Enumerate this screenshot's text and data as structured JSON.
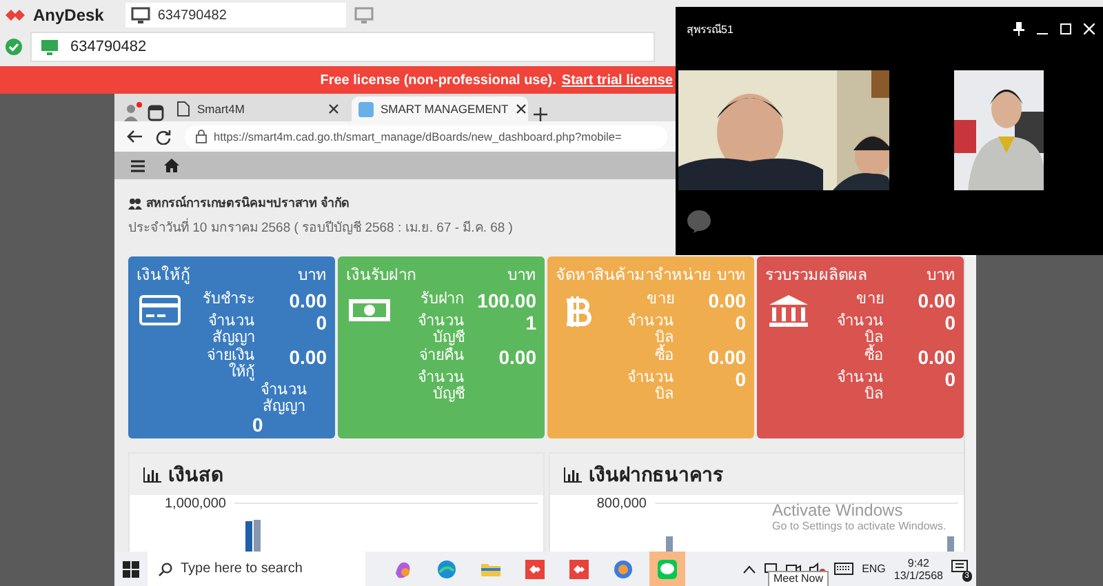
{
  "anydesk": {
    "app_name": "AnyDesk",
    "tab": {
      "label": "634790482"
    },
    "address": {
      "value": "634790482"
    },
    "banner": {
      "text": "Free license (non-professional use).",
      "link": "Start trial license"
    }
  },
  "browser": {
    "tabs": [
      {
        "label": "Smart4M",
        "selected": false
      },
      {
        "label": "SMART MANAGEMENT",
        "selected": true
      }
    ],
    "url": "https://smart4m.cad.go.th/smart_manage/dBoards/new_dashboard.php?mobile="
  },
  "page": {
    "org": "สหกรณ์การเกษตรนิคมฯปราสาท จำกัด",
    "date_line": "ประจำวันที่ 10 มกราคม 2568 ( รอบปีบัญชี 2568 : เม.ย. 67 - มี.ค. 68 )",
    "cards": [
      {
        "title": "เงินให้กู้",
        "unit": "บาท",
        "color": "#3a7bbf",
        "rows": [
          {
            "label": "รับชำระ",
            "value": "0.00"
          },
          {
            "label": "จำนวน สัญญา",
            "value": "0"
          },
          {
            "label": "จ่ายเงิน ให้กู้",
            "value": "0.00"
          },
          {
            "kind": "stacked",
            "label": "จำนวน สัญญา",
            "value": "0"
          }
        ]
      },
      {
        "title": "เงินรับฝาก",
        "unit": "บาท",
        "color": "#5cb85c",
        "rows": [
          {
            "label": "รับฝาก",
            "value": "100.00"
          },
          {
            "label": "จำนวน บัญชี",
            "value": "1"
          },
          {
            "label": "จ่ายคืน",
            "value": "0.00"
          },
          {
            "label": "จำนวน บัญชี"
          }
        ]
      },
      {
        "title": "จัดหาสินค้ามาจำหน่าย",
        "unit": "บาท",
        "color": "#f0ad4e",
        "rows": [
          {
            "label": "ขาย",
            "value": "0.00"
          },
          {
            "label": "จำนวน บิล",
            "value": "0"
          },
          {
            "label": "ซื้อ",
            "value": "0.00"
          },
          {
            "label": "จำนวน บิล",
            "value": "0"
          }
        ]
      },
      {
        "title": "รวบรวมผลิตผล",
        "unit": "บาท",
        "color": "#d9534f",
        "rows": [
          {
            "label": "ขาย",
            "value": "0.00"
          },
          {
            "label": "จำนวน บิล",
            "value": "0"
          },
          {
            "label": "ซื้อ",
            "value": "0.00"
          },
          {
            "label": "จำนวน บิล",
            "value": "0"
          }
        ]
      }
    ],
    "panels": [
      {
        "title": "เงินสด",
        "axis_label": "1,000,000"
      },
      {
        "title": "เงินฝากธนาคาร",
        "axis_label": "800,000"
      }
    ]
  },
  "call_window": {
    "title": "สุพรรณี51"
  },
  "taskbar": {
    "search_placeholder": "Type here to search",
    "language": "ENG",
    "time": "9:42",
    "date": "13/1/2568",
    "notification_count": "3",
    "tooltip": "Meet Now"
  },
  "watermark": {
    "title": "Activate Windows",
    "subtitle": "Go to Settings to activate Windows."
  }
}
